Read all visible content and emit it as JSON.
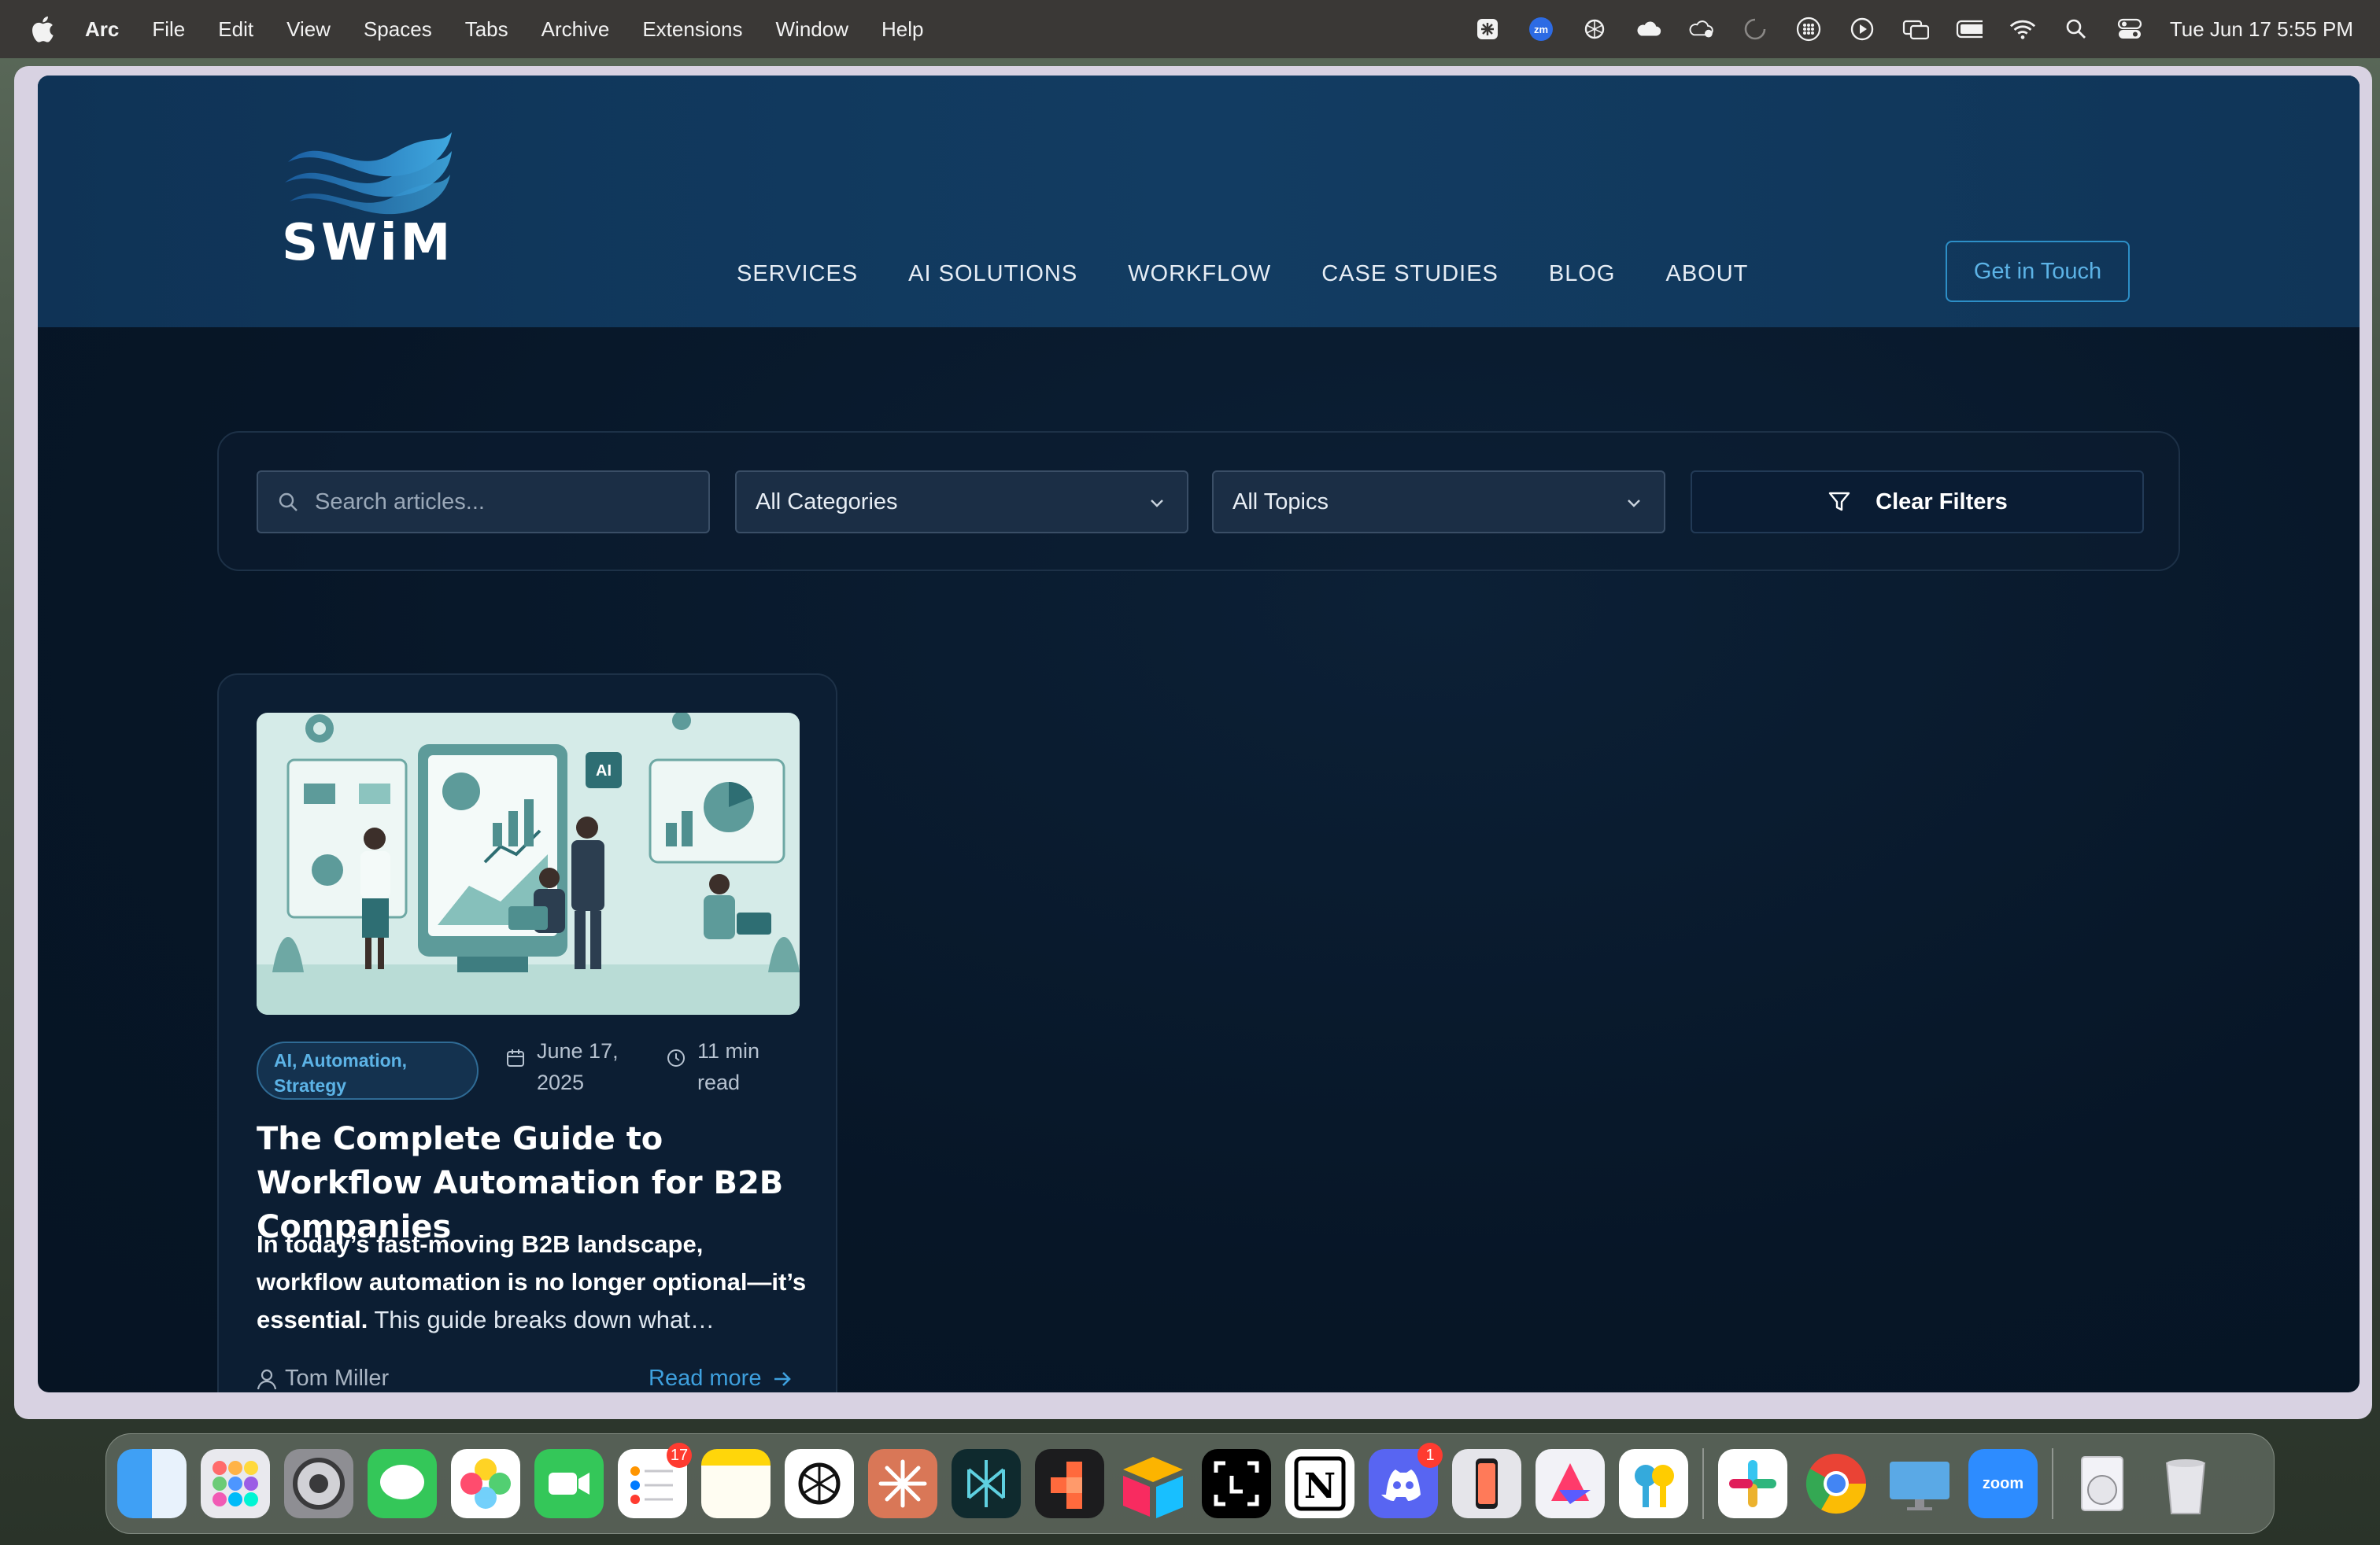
{
  "menubar": {
    "app_name": "Arc",
    "items": [
      "File",
      "Edit",
      "View",
      "Spaces",
      "Tabs",
      "Archive",
      "Extensions",
      "Window",
      "Help"
    ],
    "clock": "Tue Jun 17  5:55 PM"
  },
  "site": {
    "logo_text": "SWiM",
    "nav": [
      "SERVICES",
      "AI SOLUTIONS",
      "WORKFLOW",
      "CASE STUDIES",
      "BLOG",
      "ABOUT"
    ],
    "cta_label": "Get in Touch"
  },
  "filters": {
    "search_placeholder": "Search articles...",
    "category": "All Categories",
    "topic": "All Topics",
    "clear_label": "Clear Filters"
  },
  "article": {
    "image_text": "AI",
    "tags": "AI, Automation, Strategy",
    "date": "June 17, 2025",
    "read_time": "11 min read",
    "title": "The Complete Guide to Workflow Automation for B2B Companies",
    "excerpt_bold": "In today’s fast-moving B2B landscape, workflow automation is no longer optional—it’s essential.",
    "excerpt_rest": " This guide breaks down what…",
    "author": "Tom Miller",
    "read_more": "Read more"
  },
  "dock": {
    "reminders_badge": "17",
    "discord_badge": "1",
    "zoom_label": "zoom"
  },
  "colors": {
    "accent": "#3ea0de",
    "header_bg": "#123c62",
    "page_bg": "#071627"
  }
}
